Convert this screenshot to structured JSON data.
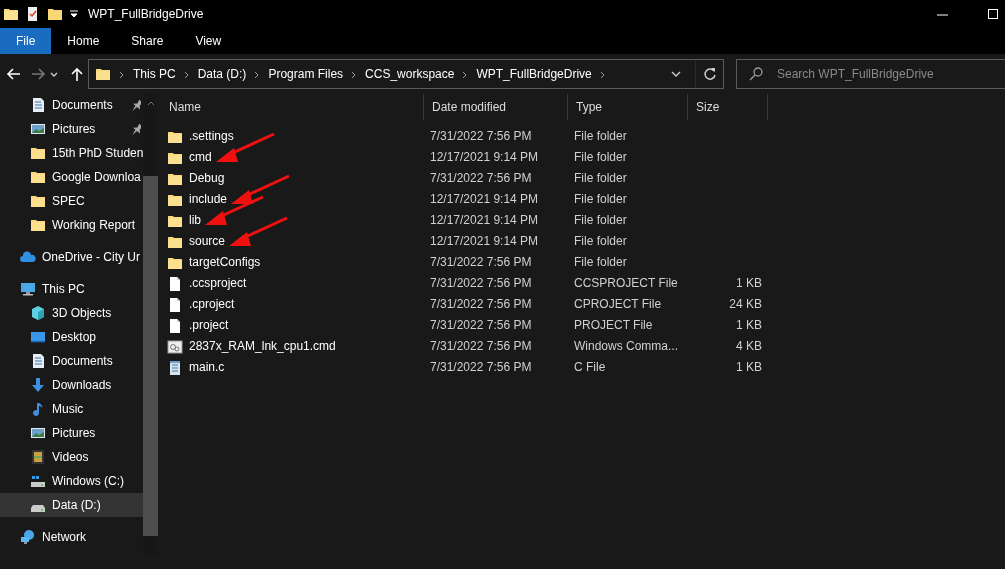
{
  "window": {
    "title": "WPT_FullBridgeDrive"
  },
  "ribbon_tabs": [
    {
      "label": "File",
      "selected": true
    },
    {
      "label": "Home",
      "selected": false
    },
    {
      "label": "Share",
      "selected": false
    },
    {
      "label": "View",
      "selected": false
    }
  ],
  "address_bar": {
    "path": [
      "This PC",
      "Data (D:)",
      "Program Files",
      "CCS_workspace",
      "WPT_FullBridgeDrive"
    ]
  },
  "search": {
    "placeholder": "Search WPT_FullBridgeDrive"
  },
  "sidebar": [
    {
      "children": [
        {
          "label": "Documents",
          "kind": "documents",
          "pinned": true,
          "selected": false
        },
        {
          "label": "Pictures",
          "kind": "pictures",
          "pinned": true,
          "selected": false
        },
        {
          "label": "15th PhD Studen",
          "kind": "folder",
          "pinned": false,
          "selected": false
        },
        {
          "label": "Google Downloa",
          "kind": "folder",
          "pinned": false,
          "selected": false
        },
        {
          "label": "SPEC",
          "kind": "folder",
          "pinned": false,
          "selected": false
        },
        {
          "label": "Working Report",
          "kind": "folder",
          "pinned": false,
          "selected": false
        }
      ]
    },
    {
      "label": "OneDrive - City Ur",
      "kind": "cloud",
      "selected": false
    },
    {
      "label": "This PC",
      "kind": "pc",
      "selected": false,
      "children": [
        {
          "label": "3D Objects",
          "kind": "cube",
          "selected": false
        },
        {
          "label": "Desktop",
          "kind": "desktop",
          "selected": false
        },
        {
          "label": "Documents",
          "kind": "documents",
          "selected": false
        },
        {
          "label": "Downloads",
          "kind": "downloads",
          "selected": false
        },
        {
          "label": "Music",
          "kind": "music",
          "selected": false
        },
        {
          "label": "Pictures",
          "kind": "pictures",
          "selected": false
        },
        {
          "label": "Videos",
          "kind": "videos",
          "selected": false
        },
        {
          "label": "Windows (C:)",
          "kind": "windrive",
          "selected": false
        },
        {
          "label": "Data (D:)",
          "kind": "drive",
          "selected": true
        }
      ]
    },
    {
      "label": "Network",
      "kind": "network",
      "selected": false
    }
  ],
  "table": {
    "columns": [
      "Name",
      "Date modified",
      "Type",
      "Size"
    ],
    "rows": [
      {
        "kind": "folder",
        "name": ".settings",
        "date": "7/31/2022 7:56 PM",
        "type": "File folder",
        "marked": false
      },
      {
        "kind": "folder",
        "name": "cmd",
        "date": "12/17/2021 9:14 PM",
        "type": "File folder",
        "marked": true
      },
      {
        "kind": "folder",
        "name": "Debug",
        "date": "7/31/2022 7:56 PM",
        "type": "File folder",
        "marked": false
      },
      {
        "kind": "folder",
        "name": "include",
        "date": "12/17/2021 9:14 PM",
        "type": "File folder",
        "marked": true
      },
      {
        "kind": "folder",
        "name": "lib",
        "date": "12/17/2021 9:14 PM",
        "type": "File folder",
        "marked": true
      },
      {
        "kind": "folder",
        "name": "source",
        "date": "12/17/2021 9:14 PM",
        "type": "File folder",
        "marked": true
      },
      {
        "kind": "folder",
        "name": "targetConfigs",
        "date": "7/31/2022 7:56 PM",
        "type": "File folder",
        "marked": false
      },
      {
        "kind": "file",
        "name": ".ccsproject",
        "date": "7/31/2022 7:56 PM",
        "type": "CCSPROJECT File",
        "size": "1 KB",
        "marked": false
      },
      {
        "kind": "file",
        "name": ".cproject",
        "date": "7/31/2022 7:56 PM",
        "type": "CPROJECT File",
        "size": "24 KB",
        "marked": false
      },
      {
        "kind": "file",
        "name": ".project",
        "date": "7/31/2022 7:56 PM",
        "type": "PROJECT File",
        "size": "1 KB",
        "marked": false
      },
      {
        "kind": "script",
        "name": "2837x_RAM_lnk_cpu1.cmd",
        "date": "7/31/2022 7:56 PM",
        "type": "Windows Comma...",
        "size": "4 KB",
        "marked": false
      },
      {
        "kind": "text",
        "name": "main.c",
        "date": "7/31/2022 7:56 PM",
        "type": "C File",
        "size": "1 KB",
        "marked": false
      }
    ]
  }
}
